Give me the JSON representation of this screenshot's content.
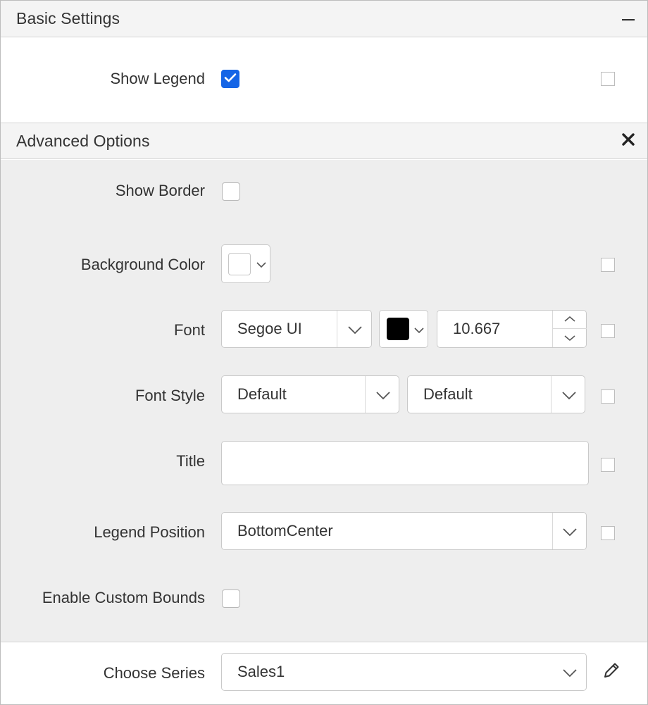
{
  "basic": {
    "title": "Basic Settings",
    "show_legend_label": "Show Legend",
    "show_legend_checked": true
  },
  "advanced": {
    "title": "Advanced Options",
    "show_border_label": "Show Border",
    "background_color_label": "Background Color",
    "background_color_value": "#ffffff",
    "font_label": "Font",
    "font_family": "Segoe UI",
    "font_color": "#000000",
    "font_size": "10.667",
    "font_style_label": "Font Style",
    "font_style_value": "Default",
    "font_weight_value": "Default",
    "title_label": "Title",
    "title_value": "",
    "legend_position_label": "Legend Position",
    "legend_position_value": "BottomCenter",
    "enable_custom_bounds_label": "Enable Custom Bounds"
  },
  "series": {
    "choose_series_label": "Choose Series",
    "choose_series_value": "Sales1"
  },
  "colors": {
    "accent": "#1565e6",
    "panel_bg": "#eeeeee",
    "header_bg": "#f4f4f4"
  },
  "icons": [
    "minimize-icon",
    "close-icon",
    "check-icon",
    "chevron-down-icon",
    "spinner-up-icon",
    "spinner-down-icon",
    "edit-pencil-icon"
  ]
}
